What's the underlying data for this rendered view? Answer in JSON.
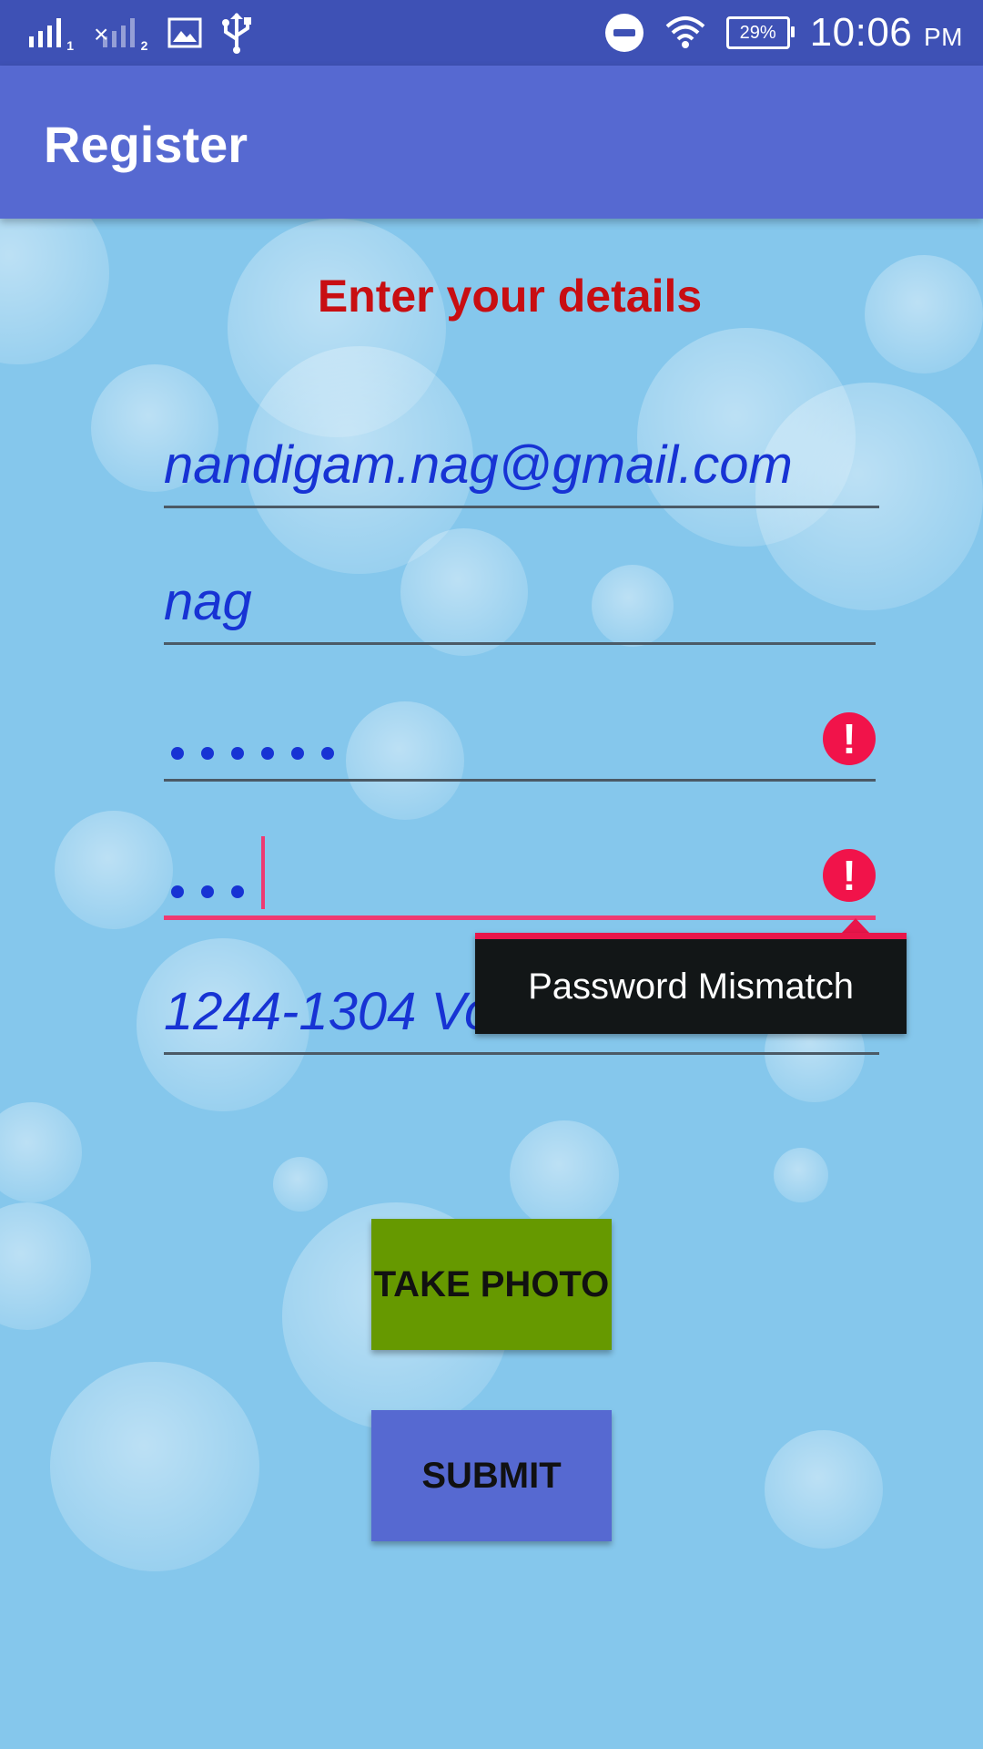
{
  "status_bar": {
    "sim1_label": "1",
    "sim2_label": "2",
    "battery": "29%",
    "time": "10:06",
    "ampm": "PM",
    "icons": [
      "signal-icon",
      "no-signal-icon",
      "image-icon",
      "usb-icon",
      "do-not-disturb-icon",
      "wifi-icon",
      "battery-icon"
    ]
  },
  "app_bar": {
    "title": "Register"
  },
  "form": {
    "heading": "Enter your details",
    "email": "nandigam.nag@gmail.com",
    "name": "nag",
    "password_dots": 6,
    "confirm_password_dots": 3,
    "address": "1244-1304 Volker Boulevard",
    "error_icon": "!",
    "error_message": "Password Mismatch"
  },
  "buttons": {
    "take_photo": "TAKE PHOTO",
    "submit": "SUBMIT"
  },
  "colors": {
    "status_bar": "#3e51b5",
    "app_bar": "#5669d1",
    "heading": "#c80e12",
    "input_text": "#1733d4",
    "error": "#f1134a",
    "take_photo_bg": "#669900",
    "submit_bg": "#5669d1"
  }
}
